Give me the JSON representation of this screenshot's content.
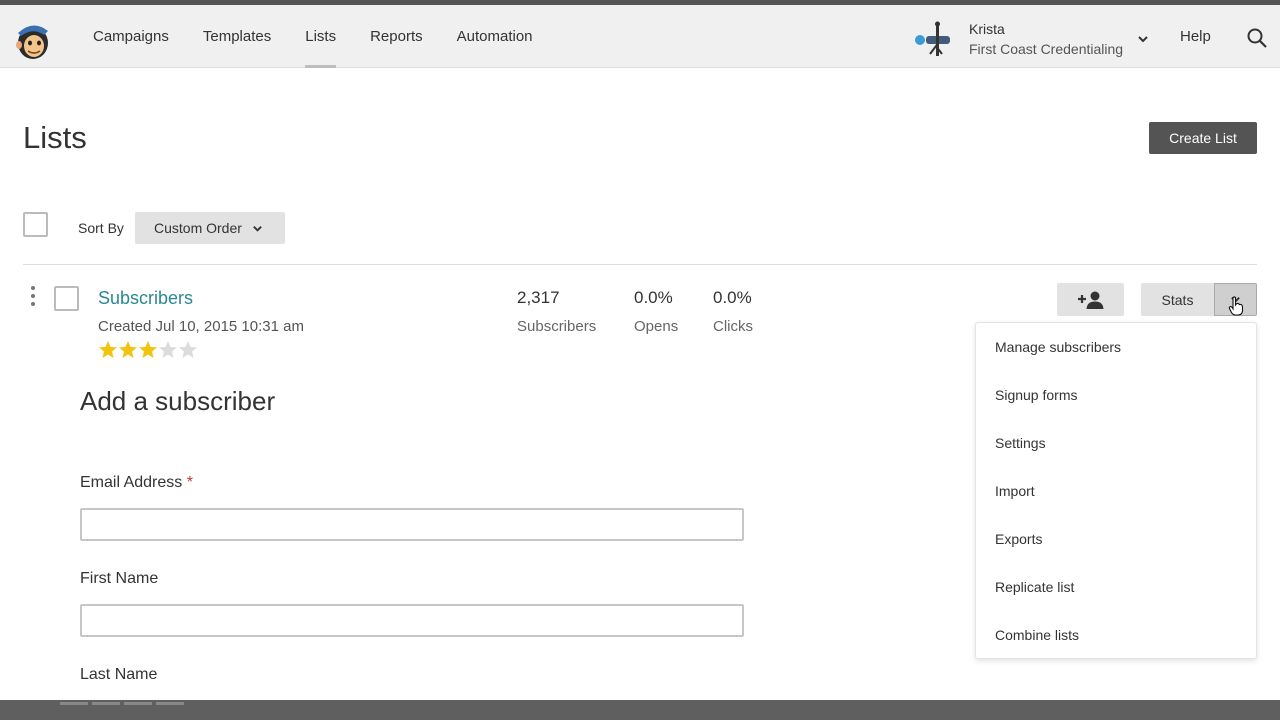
{
  "nav": {
    "items": [
      {
        "label": "Campaigns",
        "active": false
      },
      {
        "label": "Templates",
        "active": false
      },
      {
        "label": "Lists",
        "active": true
      },
      {
        "label": "Reports",
        "active": false
      },
      {
        "label": "Automation",
        "active": false
      }
    ],
    "account_name": "Krista",
    "account_org": "First Coast Credentialing",
    "help_label": "Help"
  },
  "page": {
    "title": "Lists",
    "create_label": "Create List",
    "sort_label": "Sort By",
    "sort_value": "Custom Order"
  },
  "list": {
    "name": "Subscribers",
    "created": "Created Jul 10, 2015 10:31 am",
    "rating": 3,
    "rating_max": 5,
    "stats": [
      {
        "value": "2,317",
        "label": "Subscribers"
      },
      {
        "value": "0.0%",
        "label": "Opens"
      },
      {
        "value": "0.0%",
        "label": "Clicks"
      }
    ],
    "stats_button": "Stats"
  },
  "form": {
    "title": "Add a subscriber",
    "fields": [
      {
        "label": "Email Address",
        "required": true,
        "value": ""
      },
      {
        "label": "First Name",
        "required": false,
        "value": ""
      },
      {
        "label": "Last Name",
        "required": false,
        "value": ""
      }
    ],
    "required_mark": "*"
  },
  "menu": {
    "items": [
      "Manage subscribers",
      "Signup forms",
      "Settings",
      "Import",
      "Exports",
      "Replicate list",
      "Combine lists"
    ]
  },
  "colors": {
    "link": "#2a8797",
    "star_on": "#f1c40f",
    "star_off": "#dcdcdc",
    "primary_button": "#545454",
    "required": "#c9342a"
  }
}
